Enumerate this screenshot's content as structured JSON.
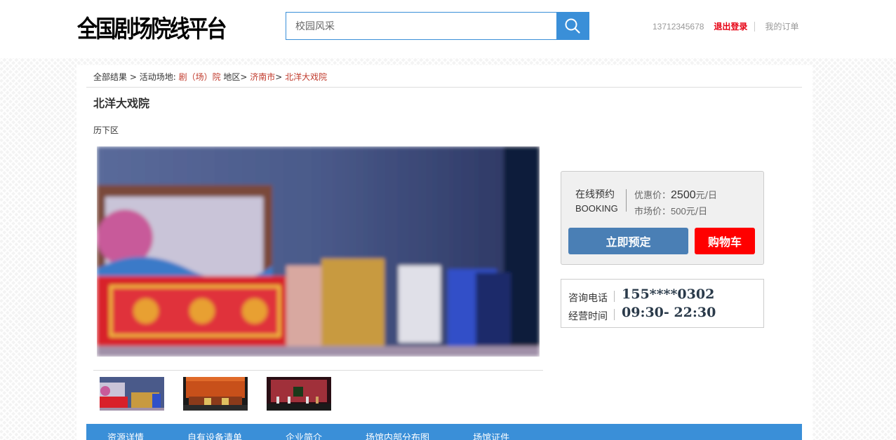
{
  "header": {
    "logo_text": "全国剧场院线平台",
    "search": {
      "value": "校园风采",
      "placeholder": ""
    },
    "search_icon": "search-icon",
    "phone": "13712345678",
    "logout_label": "退出登录",
    "orders_label": "我的订单"
  },
  "breadcrumb": {
    "all": "全部结果",
    "sep1": " > ",
    "venue_type_prefix": "活动场地: ",
    "venue_type": "剧（场）院",
    "region_prefix": " 地区> ",
    "city": "济南市",
    "sep2": "> ",
    "venue": "北洋大戏院"
  },
  "venue": {
    "title": "北洋大戏院",
    "district": "历下区"
  },
  "booking": {
    "label_cn": "在线预约",
    "label_en": "BOOKING",
    "discount_label": "优惠价：",
    "discount_price": "2500",
    "discount_unit": "元/日",
    "market_label": "市场价：",
    "market_price": "500",
    "market_unit": "元/日",
    "book_button": "立即预定",
    "cart_button": "购物车"
  },
  "contact": {
    "phone_label": "咨询电话",
    "phone_value": "155****0302",
    "hours_label": "经营时间",
    "hours_value": "09:30- 22:30"
  },
  "tabs": [
    "资源详情",
    "自有设备清单",
    "企业简介",
    "场馆内部分布图",
    "场馆证件"
  ],
  "colors": {
    "accent_blue": "#3a8fd8",
    "book_button": "#4a7fb5",
    "cart_button": "#ff0000",
    "link_red": "#c0392b",
    "logout_red": "#e60012"
  }
}
